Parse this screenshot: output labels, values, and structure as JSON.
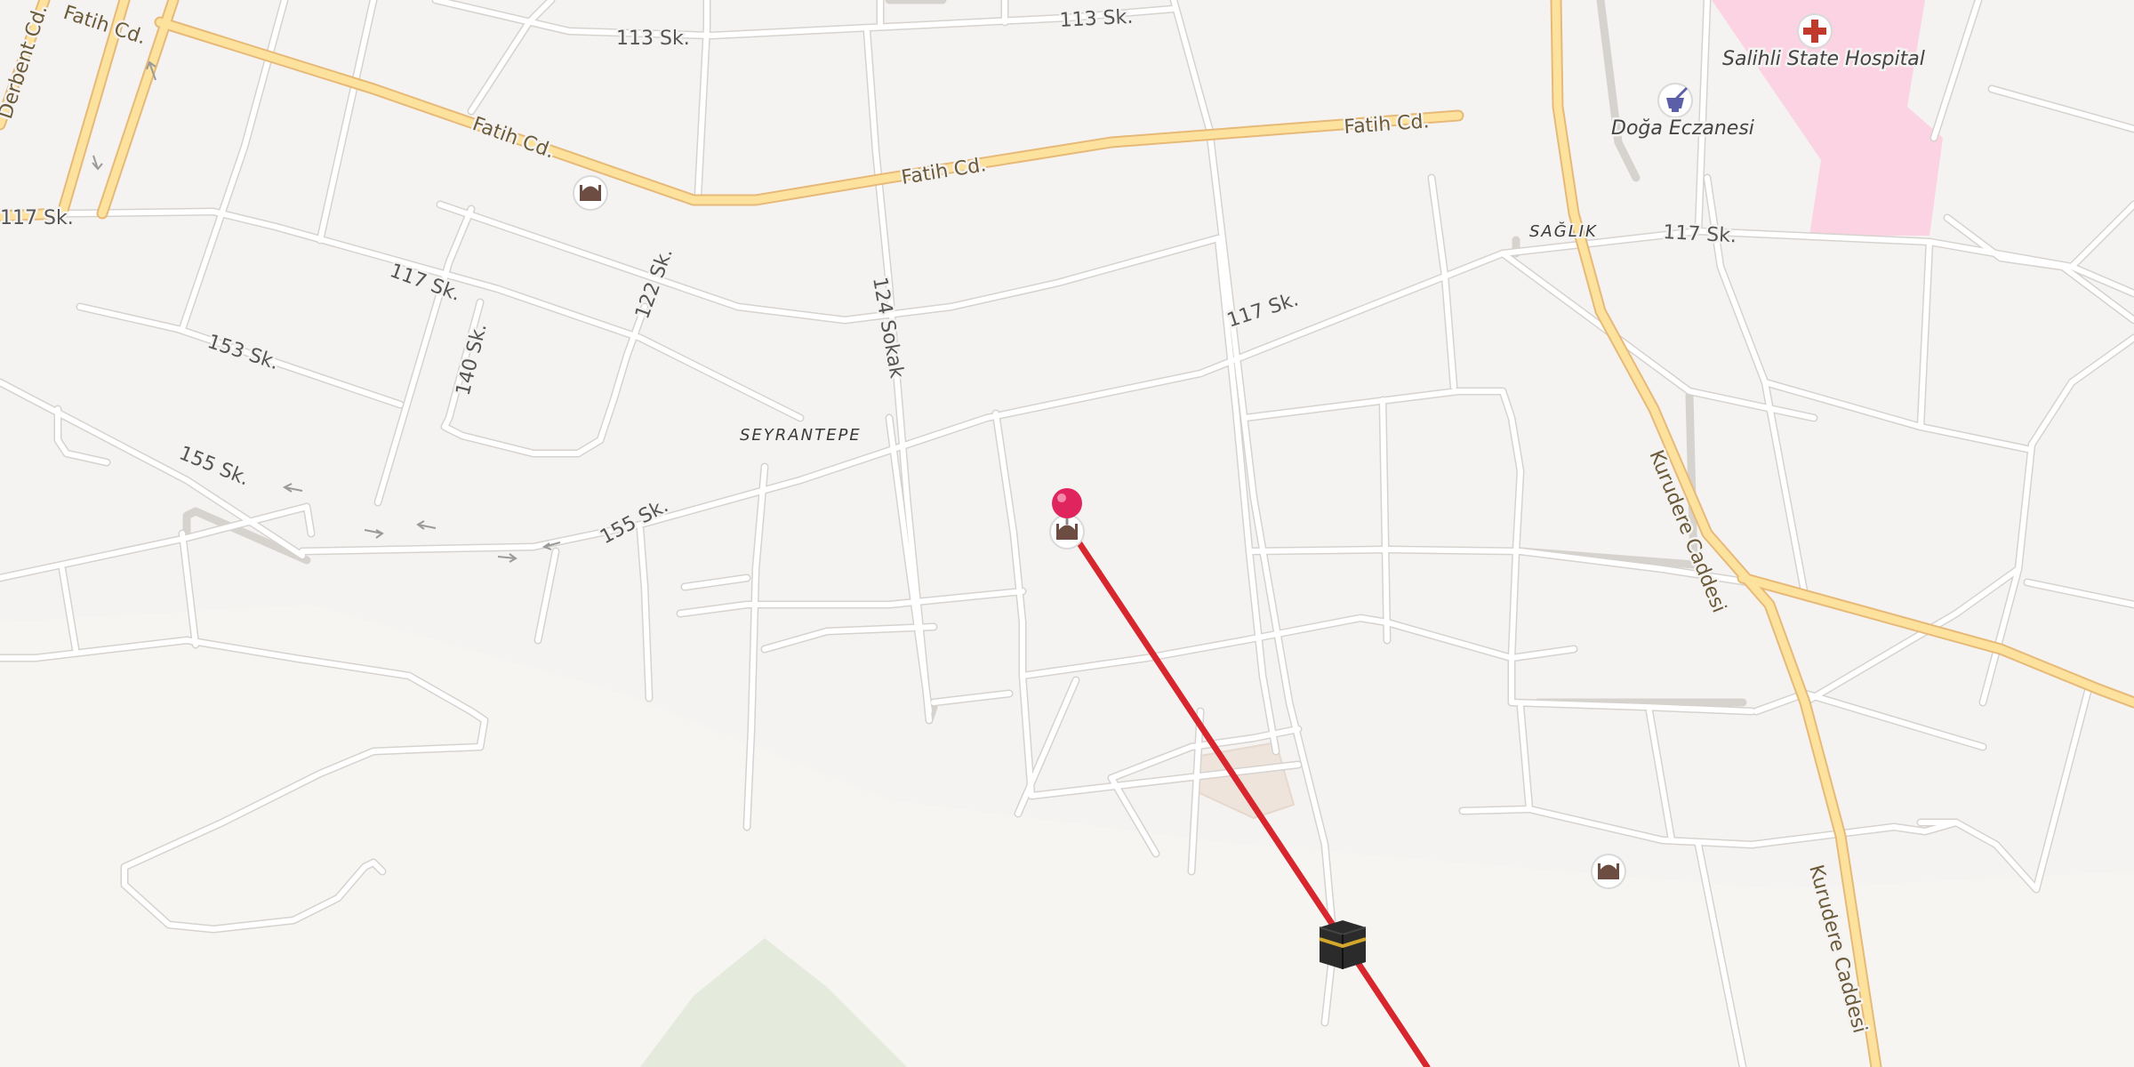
{
  "map": {
    "colors": {
      "background": "#f5f3f1",
      "major_road": "#fde29e",
      "minor_road": "#ffffff",
      "hospital_area": "#fbd3e3",
      "park": "#e4ebdd",
      "route_line": "#d7262e",
      "marker": "#e0245e"
    },
    "streets": {
      "s113_a": "113 Sk.",
      "s113_b": "113 Sk.",
      "fatih_a": "Fatih Cd.",
      "fatih_b": "Fatih Cd.",
      "fatih_c": "Fatih Cd.",
      "fatih_d": "Fatih Cd.",
      "derbent": "Derbent Cd.",
      "s117_a": "117 Sk.",
      "s117_b": "117 Sk.",
      "s117_c": "117 Sk.",
      "s117_d": "117 Sk.",
      "s122": "122 Sk.",
      "s124": "124 Sokak",
      "s153": "153 Sk.",
      "s140": "140 Sk.",
      "s155_a": "155 Sk.",
      "s155_b": "155 Sk.",
      "kurudere_a": "Kurudere Caddesi",
      "kurudere_b": "Kurudere Caddesi"
    },
    "areas": {
      "seyrantepe": "SEYRANTEPE",
      "saglik": "SAĞLIK"
    },
    "pois": {
      "hospital": "Salihli State Hospital",
      "pharmacy": "Doğa Eczanesi"
    },
    "icons": {
      "hospital": "hospital-cross-icon",
      "pharmacy": "pharmacy-mortar-icon",
      "mosque": "mosque-icon",
      "kaaba": "kaaba-icon",
      "marker": "location-pin-icon"
    }
  }
}
